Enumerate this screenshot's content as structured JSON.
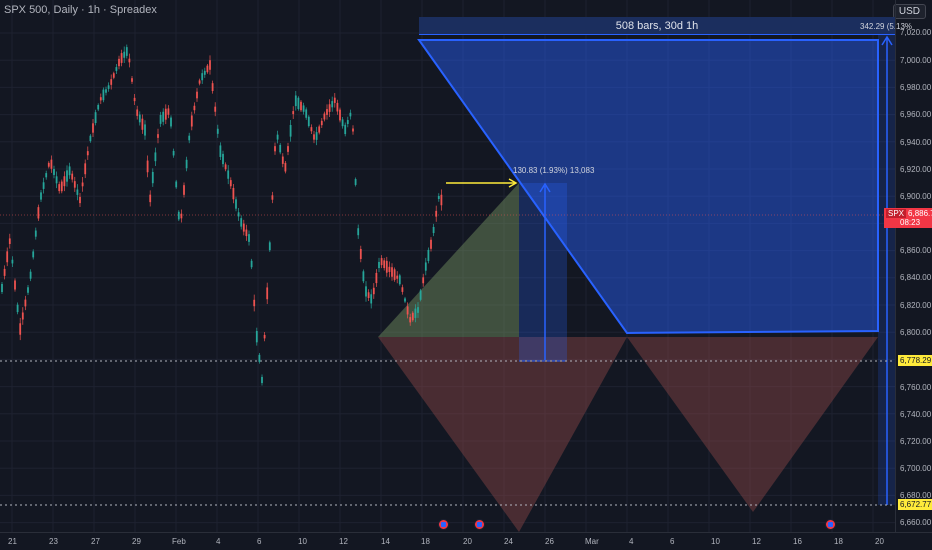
{
  "header": {
    "title": "SPX 500, Daily · 1h · Spreadex",
    "currency": "USD"
  },
  "range_banner": "508 bars, 30d 1h",
  "measure_top_label": "342.29 (5.13%",
  "measure_mid_label": "130.83 (1.93%) 13,083",
  "price_axis": {
    "ticks": [
      "7,020.00",
      "7,000.00",
      "6,980.00",
      "6,960.00",
      "6,940.00",
      "6,920.00",
      "6,900.00",
      "6,860.00",
      "6,840.00",
      "6,820.00",
      "6,800.00",
      "6,760.00",
      "6,740.00",
      "6,720.00",
      "6,700.00",
      "6,680.00",
      "6,660.00"
    ],
    "current_symbol": "SPX",
    "current_price": "6,886.78",
    "current_countdown": "08:23",
    "level_upper": "6,778.29",
    "level_lower": "6,672.77"
  },
  "time_axis": {
    "labels": [
      "21",
      "23",
      "27",
      "29",
      "Feb",
      "4",
      "6",
      "10",
      "12",
      "14",
      "18",
      "20",
      "24",
      "26",
      "Mar",
      "4",
      "6",
      "10",
      "12",
      "16",
      "18",
      "20"
    ]
  },
  "colors": {
    "background": "#131722",
    "up_candle": "#26a69a",
    "down_candle": "#ef5350",
    "measure_blue": "#2962ff",
    "yellow_arrow": "#ffeb3b"
  },
  "icons": [
    "economic-event-icon",
    "economic-event-icon",
    "economic-event-icon"
  ]
}
